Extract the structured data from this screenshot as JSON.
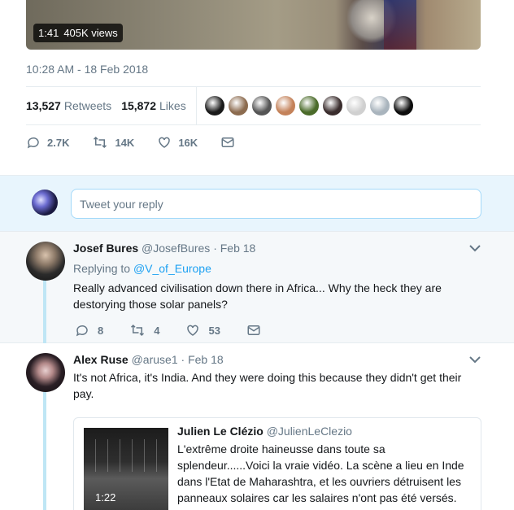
{
  "media": {
    "duration": "1:41",
    "views": "405K views"
  },
  "tweet_meta": {
    "timestamp": "10:28 AM - 18 Feb 2018"
  },
  "stats": {
    "retweets_count": "13,527",
    "retweets_label": "Retweets",
    "likes_count": "15,872",
    "likes_label": "Likes",
    "liker_avatar_colors": [
      "#1a1a1a",
      "#8c6b4f",
      "#555555",
      "#c4825a",
      "#4b6b2a",
      "#3a2d2d",
      "#d0d0d0",
      "#a9b4bd",
      "#0d0d0d"
    ]
  },
  "actions": {
    "replies": "2.7K",
    "retweets": "14K",
    "likes": "16K"
  },
  "reply_box": {
    "placeholder": "Tweet your reply"
  },
  "replies": [
    {
      "name": "Josef Bures",
      "handle": "@JosefBures",
      "date": "· Feb 18",
      "replying_prefix": "Replying to",
      "replying_to": "@V_of_Europe",
      "text": "Really advanced civilisation down there in Africa... Why the heck they are destorying those solar panels?",
      "reply_count": "8",
      "retweet_count": "4",
      "like_count": "53"
    },
    {
      "name": "Alex Ruse",
      "handle": "@aruse1",
      "date": "· Feb 18",
      "text": "It's not Africa, it's India. And they were doing this because they didn't get their pay.",
      "quote": {
        "name": "Julien Le Clézio",
        "handle": "@JulienLeClezio",
        "text": "L'extrême droite haineusse dans toute sa splendeur......Voici la vraie vidéo. La scène a lieu en Inde dans l'Etat de Maharashtra, et les ouvriers détruisent les panneaux solaires car les salaires n'ont pas été versés.",
        "video_duration": "1:22"
      }
    }
  ],
  "colors": {
    "accent": "#1da1f2",
    "muted": "#657786",
    "reply_bg": "#e8f5fd",
    "thread_line": "#bfe6f5"
  }
}
